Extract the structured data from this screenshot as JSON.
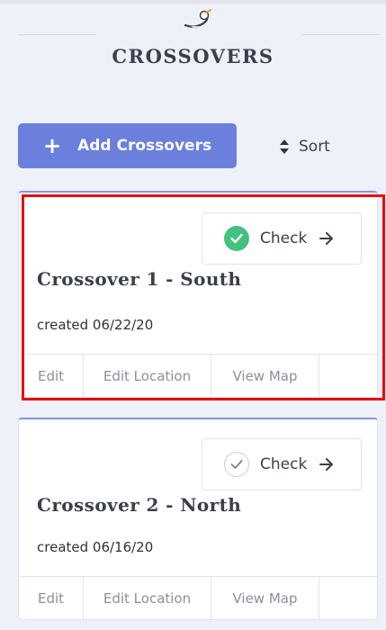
{
  "header": {
    "title": "CROSSOVERS"
  },
  "toolbar": {
    "add_label": "Add Crossovers",
    "sort_label": "Sort"
  },
  "colors": {
    "accent": "#6b7fdc",
    "check_done": "#43c17e",
    "highlight": "#e8090f"
  },
  "crossovers": [
    {
      "title": "Crossover 1 - South",
      "created": "created 06/22/20",
      "check_label": "Check",
      "checked": true,
      "actions": {
        "edit": "Edit",
        "edit_location": "Edit Location",
        "view_map": "View Map"
      }
    },
    {
      "title": "Crossover 2 - North",
      "created": "created 06/16/20",
      "check_label": "Check",
      "checked": false,
      "actions": {
        "edit": "Edit",
        "edit_location": "Edit Location",
        "view_map": "View Map"
      }
    }
  ]
}
